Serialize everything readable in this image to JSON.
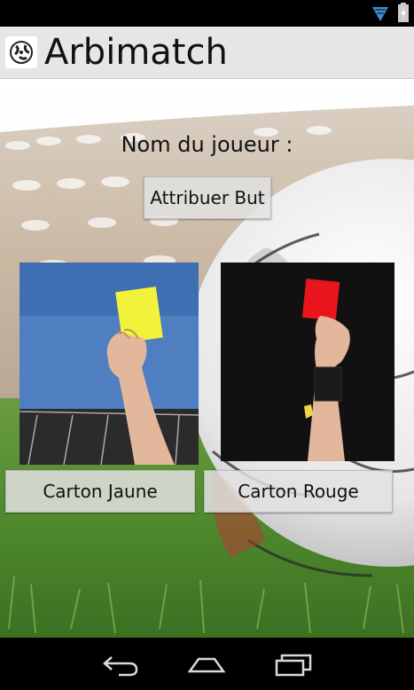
{
  "app": {
    "title": "Arbimatch"
  },
  "main": {
    "player_label": "Nom du joueur :",
    "goal_button": "Attribuer But",
    "yellow_card_button": "Carton Jaune",
    "red_card_button": "Carton Rouge",
    "yellow_card_photo_icon": "referee-yellow-card-icon",
    "red_card_photo_icon": "referee-red-card-icon"
  },
  "nav": {
    "back_icon": "back-icon",
    "home_icon": "home-icon",
    "recent_icon": "recent-apps-icon"
  },
  "colors": {
    "status_bar": "#000000",
    "action_bar": "#e6e6e6",
    "wifi": "#3b8fd9",
    "yellow_card": "#f2f23a",
    "red_card": "#e8151c",
    "sky": "#4f7fc0",
    "grass": "#4f8a2e"
  }
}
